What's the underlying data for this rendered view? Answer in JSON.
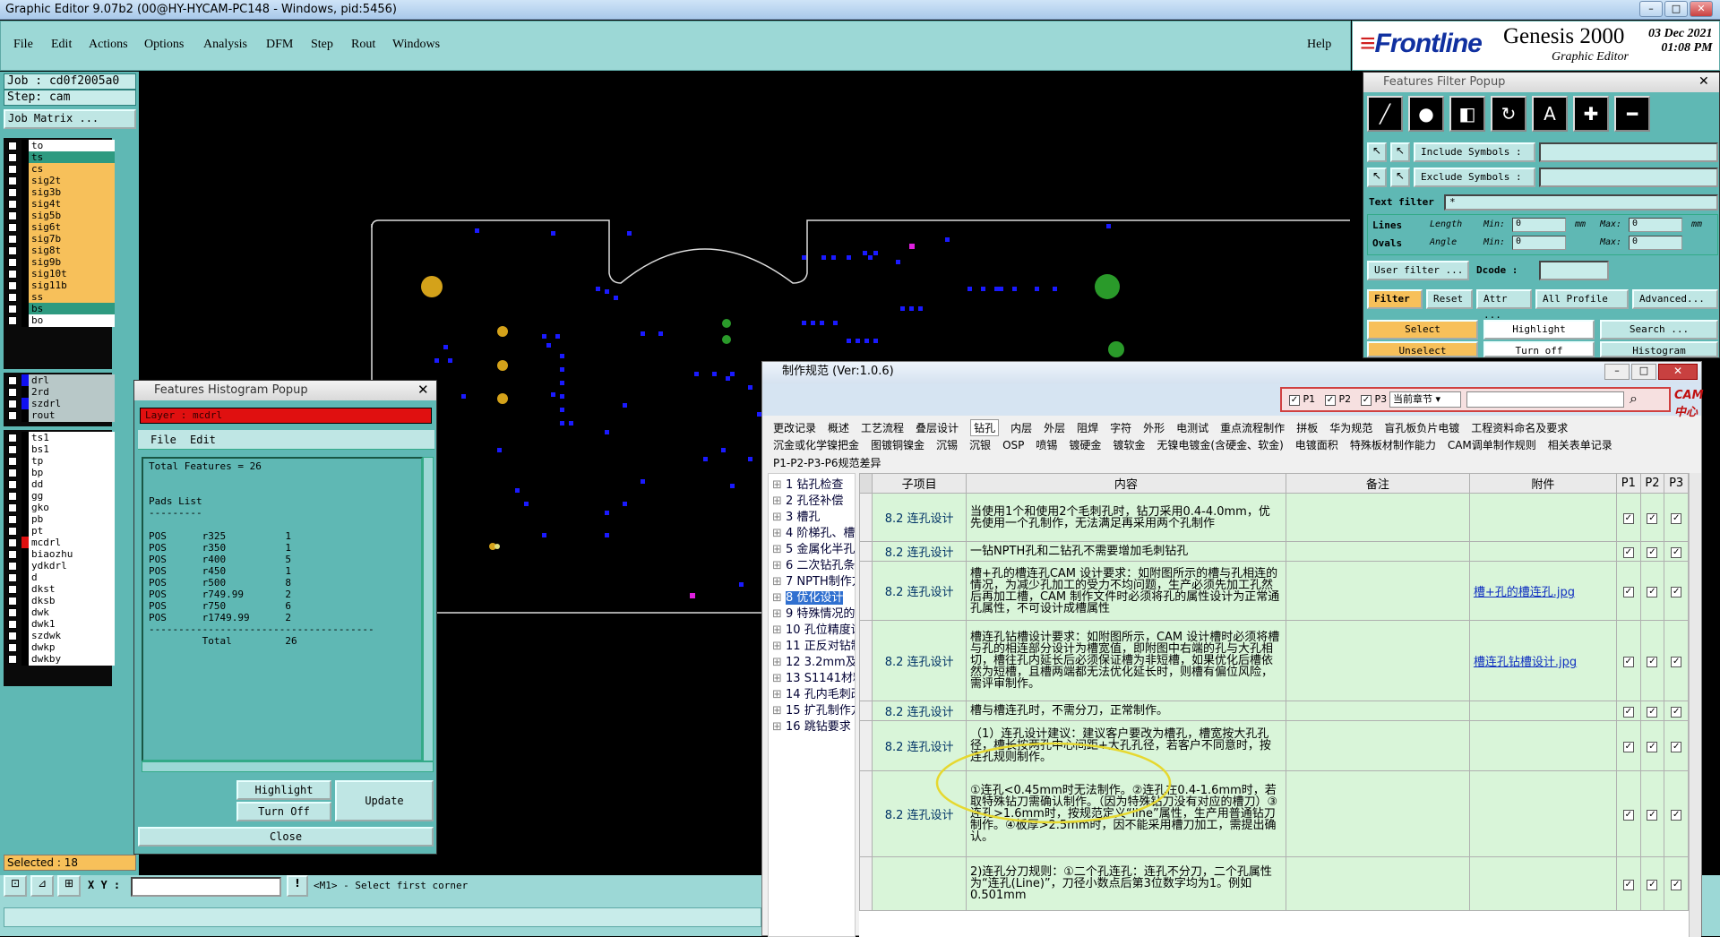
{
  "window": {
    "title": "Graphic Editor 9.07b2 (00@HY-HYCAM-PC148 - Windows, pid:5456)"
  },
  "menu": [
    "File",
    "Edit",
    "Actions",
    "Options",
    "Analysis",
    "DFM",
    "Step",
    "Rout",
    "Windows"
  ],
  "help": "Help",
  "brand": {
    "name": "Frontline",
    "product": "Genesis 2000",
    "sub": "Graphic Editor",
    "date": "03 Dec 2021",
    "time": "01:08 PM"
  },
  "job": {
    "job": "Job : cd0f2005a0",
    "step": "Step: cam",
    "matrix_btn": "Job Matrix ..."
  },
  "layers_top": [
    {
      "name": "to",
      "style": "w"
    },
    {
      "name": "ts",
      "style": "g"
    },
    {
      "name": "cs",
      "style": "o"
    },
    {
      "name": "sig2t",
      "style": "o"
    },
    {
      "name": "sig3b",
      "style": "o"
    },
    {
      "name": "sig4t",
      "style": "o"
    },
    {
      "name": "sig5b",
      "style": "o"
    },
    {
      "name": "sig6t",
      "style": "o"
    },
    {
      "name": "sig7b",
      "style": "o"
    },
    {
      "name": "sig8t",
      "style": "o"
    },
    {
      "name": "sig9b",
      "style": "o"
    },
    {
      "name": "sig10t",
      "style": "o"
    },
    {
      "name": "sig11b",
      "style": "o"
    },
    {
      "name": "ss",
      "style": "o"
    },
    {
      "name": "bs",
      "style": "g"
    },
    {
      "name": "bo",
      "style": "w"
    }
  ],
  "layers_drill": [
    {
      "name": "drl",
      "style": "gy"
    },
    {
      "name": "2rd",
      "style": "gy"
    },
    {
      "name": "szdrl",
      "style": "gy"
    },
    {
      "name": "rout",
      "style": "gy"
    }
  ],
  "layers_misc": [
    {
      "name": "ts1",
      "style": "w"
    },
    {
      "name": "bs1",
      "style": "w"
    },
    {
      "name": "tp",
      "style": "w"
    },
    {
      "name": "bp",
      "style": "w"
    },
    {
      "name": "dd",
      "style": "w"
    },
    {
      "name": "gg",
      "style": "w"
    },
    {
      "name": "gko",
      "style": "w"
    },
    {
      "name": "pb",
      "style": "w"
    },
    {
      "name": "pt",
      "style": "w"
    },
    {
      "name": "mcdrl",
      "style": "w"
    },
    {
      "name": "biaozhu",
      "style": "w"
    },
    {
      "name": "ydkdrl",
      "style": "w"
    },
    {
      "name": "d",
      "style": "w"
    },
    {
      "name": "dkst",
      "style": "w"
    },
    {
      "name": "dksb",
      "style": "w"
    },
    {
      "name": "dwk",
      "style": "w"
    },
    {
      "name": "dwk1",
      "style": "w"
    },
    {
      "name": "szdwk",
      "style": "w"
    },
    {
      "name": "dwkp",
      "style": "w"
    },
    {
      "name": "dwkby",
      "style": "w"
    }
  ],
  "status": {
    "selected": "Selected : 18",
    "xy_label": "X Y :",
    "prompt": "<M1> - Select first corner"
  },
  "histogram": {
    "title": "Features Histogram Popup",
    "layer": "Layer : mcdrl",
    "menu": [
      "File",
      "Edit"
    ],
    "body": "Total Features = 26\n\n\nPads List\n---------\n\nPOS      r325          1\nPOS      r350          1\nPOS      r400          5\nPOS      r450          1\nPOS      r500          8\nPOS      r749.99       2\nPOS      r750          6\nPOS      r1749.99      2\n--------------------------------------\n         Total         26",
    "highlight": "Highlight",
    "turn_off": "Turn Off",
    "update": "Update",
    "close": "Close"
  },
  "filter": {
    "title": "Features Filter Popup",
    "include": "Include Symbols :",
    "exclude": "Exclude Symbols :",
    "text_filter": "Text filter",
    "text_filter_val": "*",
    "lines": "Lines",
    "ovals": "Ovals",
    "length": "Length",
    "angle": "Angle",
    "min": "Min:",
    "max": "Max:",
    "min_val": "0",
    "max_val": "0",
    "unit": "mm",
    "user_filter": "User filter ...",
    "dcode": "Dcode :",
    "filter": "Filter",
    "reset": "Reset",
    "attr": "Attr ...",
    "profile": "All Profile",
    "advanced": "Advanced...",
    "select": "Select",
    "highlight": "Highlight",
    "search": "Search ...",
    "unselect": "Unselect",
    "turn_off": "Turn off",
    "histogram": "Histogram"
  },
  "doc": {
    "title": "制作规范 (Ver:1.0.6)",
    "filters": [
      "P1",
      "P2",
      "P3"
    ],
    "chapter": "当前章节",
    "logo": "CAM中心",
    "tabs1": [
      "更改记录",
      "概述",
      "工艺流程",
      "叠层设计",
      "钻孔",
      "内层",
      "外层",
      "阻焊",
      "字符",
      "外形",
      "电测试",
      "重点流程制作",
      "拼板",
      "华为规范",
      "盲孔板负片电镀",
      "工程资料命名及要求"
    ],
    "tabs2": [
      "沉金或化学镍把金",
      "图镀铜镍金",
      "沉锡",
      "沉银",
      "OSP",
      "喷锡",
      "镀硬金",
      "镀软金",
      "无镍电镀金(含硬金、软金)",
      "电镀面积",
      "特殊板材制作能力",
      "CAM调单制作规则",
      "相关表单记录"
    ],
    "tabs3": [
      "P1-P2-P3-P6规范差异"
    ],
    "tree": [
      "1 钻孔检查",
      "2 孔径补偿",
      "3 槽孔",
      "4 阶梯孔、槽",
      "5 金属化半孔",
      "6 二次钻孔条",
      "7 NPTH制作方",
      "8 优化设计",
      "9 特殊情况的",
      "10 孔位精度设",
      "11 正反对钻制",
      "12 3.2mm及以",
      "13 S1141材料",
      "14 孔内毛刺改",
      "15 扩孔制作方",
      "16 跳钻要求"
    ],
    "headers": [
      "子项目",
      "内容",
      "备注",
      "附件",
      "P1",
      "P2",
      "P3"
    ],
    "rows": [
      {
        "sub": "8.2 连孔设计",
        "content": "当使用1个和使用2个毛刺孔时，钻刀采用0.4-4.0mm，优先使用一个孔制作，无法满足再采用两个孔制作",
        "note": "",
        "att": ""
      },
      {
        "sub": "8.2 连孔设计",
        "content": "一钻NPTH孔和二钻孔不需要增加毛刺钻孔",
        "note": "",
        "att": ""
      },
      {
        "sub": "8.2 连孔设计",
        "content": "槽+孔的槽连孔CAM 设计要求：如附图所示的槽与孔相连的情况，为减少孔加工的受力不均问题，生产必须先加工孔然后再加工槽，CAM 制作文件时必须将孔的属性设计为正常通孔属性，不可设计成槽属性",
        "note": "",
        "att": "槽+孔的槽连孔.jpg"
      },
      {
        "sub": "8.2 连孔设计",
        "content": "槽连孔钻槽设计要求：如附图所示，CAM 设计槽时必须将槽与孔的相连部分设计为槽宽值，即附图中右端的孔与大孔相切，槽往孔内延长后必须保证槽为非短槽，如果优化后槽依然为短槽，且槽两端都无法优化延长时，则槽有偏位风险，需评审制作。",
        "note": "",
        "att": "槽连孔钻槽设计.jpg"
      },
      {
        "sub": "8.2 连孔设计",
        "content": "槽与槽连孔时，不需分刀，正常制作。",
        "note": "",
        "att": ""
      },
      {
        "sub": "8.2 连孔设计",
        "content": "（1）连孔设计建议：建议客户要改为槽孔，槽宽按大孔孔径，槽长按两孔中心间距+大孔孔径，若客户不同意时，按连孔规则制作。",
        "note": "",
        "att": ""
      },
      {
        "sub": "8.2 连孔设计",
        "content": "①连孔<0.45mm时无法制作。②连孔在0.4-1.6mm时，若取特殊钻刀需确认制作。（因为特殊钻刀没有对应的槽刀）③连孔>1.6mm时，按规范定义“line”属性，生产用普通钻刀制作。④板厚>2.5mm时，因不能采用槽刀加工，需提出确认。",
        "note": "",
        "att": ""
      },
      {
        "sub": "",
        "content": "2)连孔分刀规则：①二个孔连孔：连孔不分刀，二个孔属性为“连孔(Line)”，刀径小数点后第3位数字均为1。例如0.501mm",
        "note": "",
        "att": ""
      }
    ]
  }
}
